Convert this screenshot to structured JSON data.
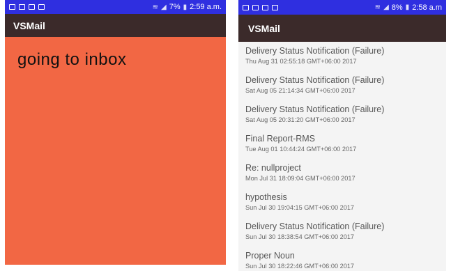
{
  "left_screen": {
    "status_time": "2:59 a.m.",
    "battery": "7%",
    "app_title": "VSMail",
    "message": "going to inbox"
  },
  "right_screen": {
    "status_time": "2:58 a.m",
    "battery": "8%",
    "app_title": "VSMail",
    "emails": [
      {
        "subject": "Delivery Status Notification (Failure)",
        "date": "Thu Aug 31 02:55:18 GMT+06:00 2017"
      },
      {
        "subject": "Delivery Status Notification (Failure)",
        "date": "Sat Aug 05 21:14:34 GMT+06:00 2017"
      },
      {
        "subject": "Delivery Status Notification (Failure)",
        "date": "Sat Aug 05 20:31:20 GMT+06:00 2017"
      },
      {
        "subject": "Final Report-RMS",
        "date": "Tue Aug 01 10:44:24 GMT+06:00 2017"
      },
      {
        "subject": "Re: nullproject",
        "date": "Mon Jul 31 18:09:04 GMT+06:00 2017"
      },
      {
        "subject": "hypothesis",
        "date": "Sun Jul 30 19:04:15 GMT+06:00 2017"
      },
      {
        "subject": "Delivery Status Notification (Failure)",
        "date": "Sun Jul 30 18:38:54 GMT+06:00 2017"
      },
      {
        "subject": "Proper Noun",
        "date": "Sun Jul 30 18:22:46 GMT+06:00 2017"
      }
    ]
  },
  "colors": {
    "status_bar": "#2f2fe0",
    "app_bar": "#3b2a2a",
    "loading_background": "#f26744",
    "list_background": "#f4f4f4"
  },
  "icons": [
    "notification-icon",
    "image-icon",
    "message-icon",
    "mail-icon",
    "wifi-icon",
    "signal-icon",
    "battery-icon"
  ]
}
